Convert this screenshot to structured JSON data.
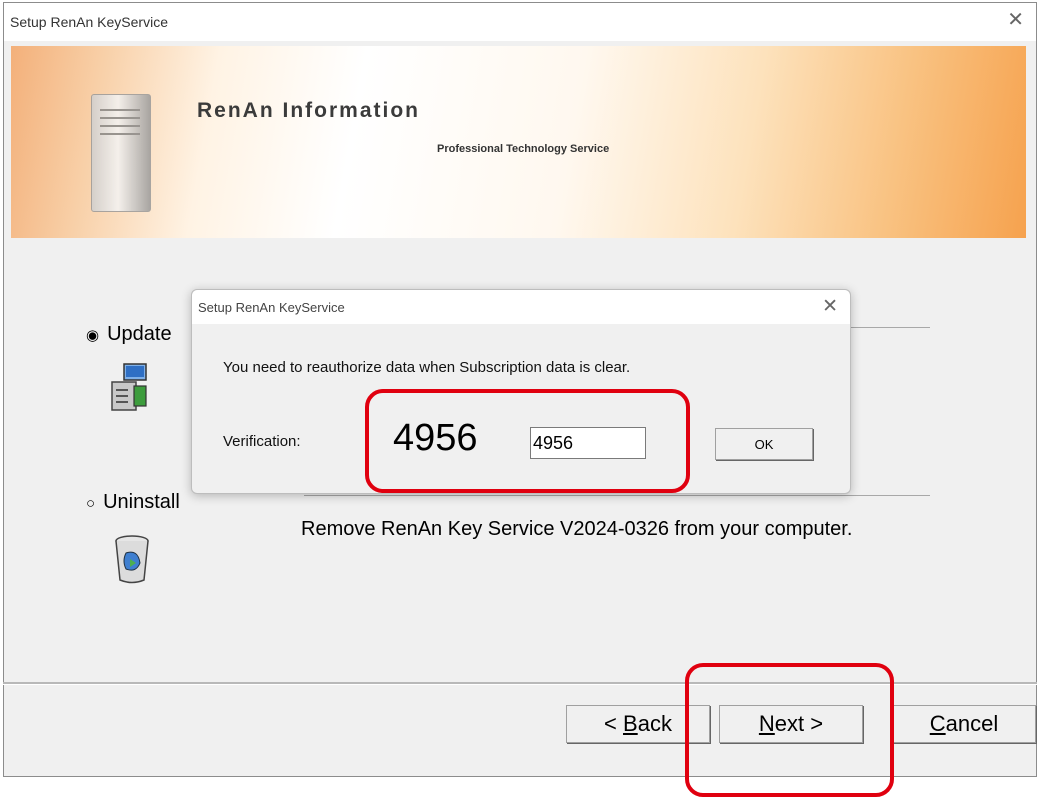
{
  "window": {
    "title": "Setup RenAn KeyService",
    "close_glyph": "✕"
  },
  "banner": {
    "title": "RenAn Information",
    "subtitle": "Professional Technology Service"
  },
  "options": {
    "update_label": "Update",
    "uninstall_label": "Uninstall",
    "uninstall_description": "Remove RenAn Key Service V2024-0326 from your computer."
  },
  "buttons": {
    "back_underline": "B",
    "back_rest": "ack",
    "back_prefix": "< ",
    "next_underline": "N",
    "next_rest": "ext >",
    "cancel_underline": "C",
    "cancel_rest": "ancel"
  },
  "dialog": {
    "title": "Setup RenAn KeyService",
    "close_glyph": "✕",
    "message": "You need to reauthorize data when Subscription data is clear.",
    "verification_label": "Verification:",
    "verification_code": "4956",
    "verification_input_value": "4956",
    "ok_label": "OK"
  },
  "colors": {
    "highlight": "#e0000f",
    "window_bg": "#f0f0f0"
  }
}
